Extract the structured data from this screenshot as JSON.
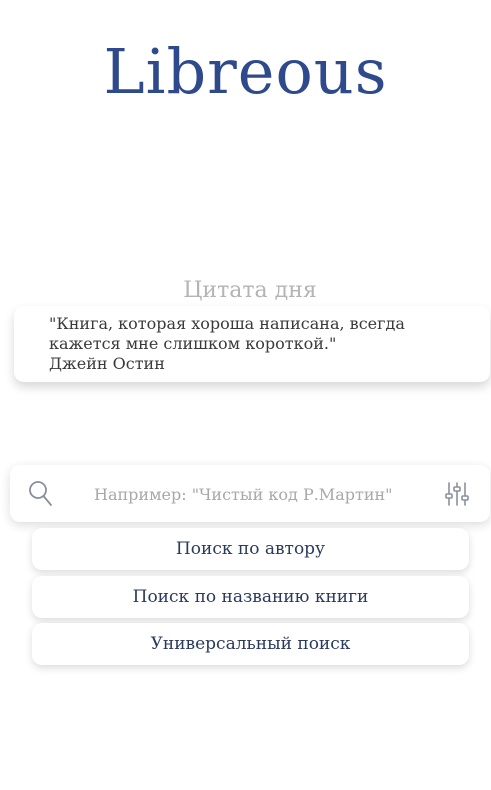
{
  "app": {
    "title": "Libreous"
  },
  "quote": {
    "heading": "Цитата дня",
    "text": "\"Книга, которая хороша написана, всегда кажется мне слишком короткой.\"",
    "author": "Джейн Остин"
  },
  "search": {
    "placeholder": "Например: \"Чистый код Р.Мартин\"",
    "value": "",
    "search_icon": "search-icon",
    "filter_icon": "sliders-icon"
  },
  "search_options": [
    {
      "label": "Поиск по автору"
    },
    {
      "label": "Поиск по названию книги"
    },
    {
      "label": "Универсальный поиск"
    }
  ],
  "colors": {
    "brand": "#2e4a8c",
    "heading_muted": "#b4b4b4",
    "text": "#3a3a3a",
    "button_text": "#2a3a5c",
    "icon": "#8a8f9c"
  }
}
